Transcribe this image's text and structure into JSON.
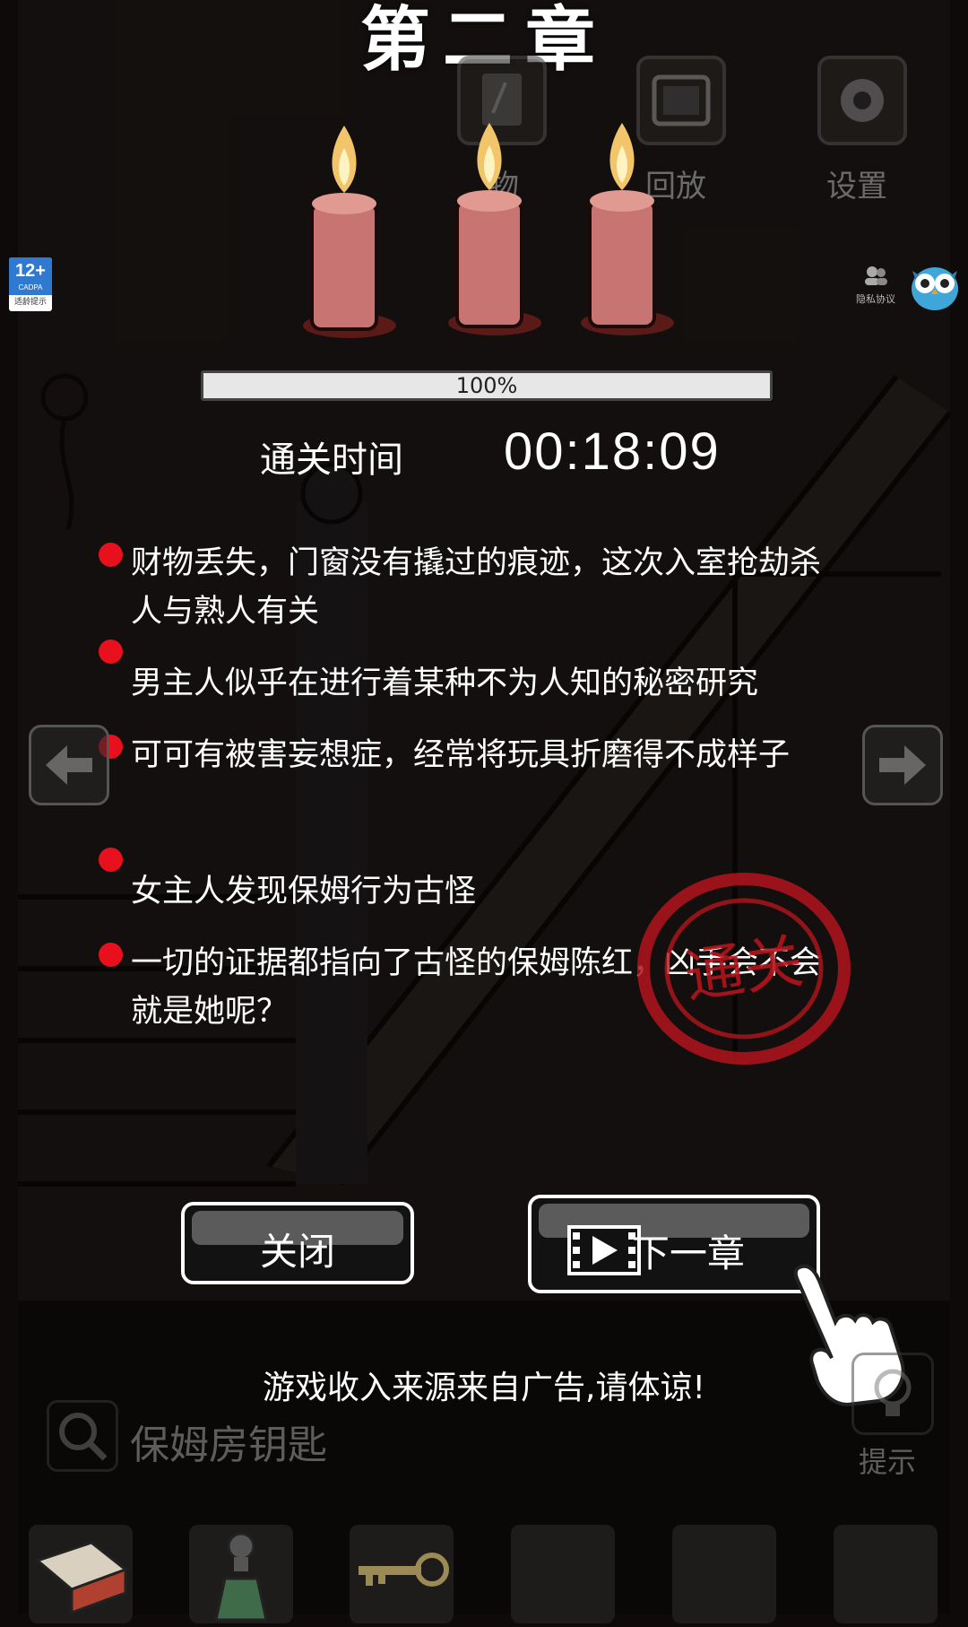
{
  "chapter_title": "第二章",
  "top_bar": {
    "items_label": "物",
    "replay_label": "回放",
    "settings_label": "设置"
  },
  "age_rating": {
    "age": "12+",
    "org": "CADPA",
    "note": "适龄提示"
  },
  "privacy_label": "隐私协议",
  "progress": {
    "text": "100%",
    "value": 1.0
  },
  "clear_time": {
    "label": "通关时间",
    "value": "00:18:09"
  },
  "clues": [
    "财物丢失，门窗没有撬过的痕迹，这次入室抢劫杀人与熟人有关",
    "男主人似乎在进行着某种不为人知的秘密研究",
    "可可有被害妄想症，经常将玩具折磨得不成样子",
    "女主人发现保姆行为古怪",
    "一切的证据都指向了古怪的保姆陈红，凶手会不会就是她呢？"
  ],
  "stamp_text": "通关",
  "buttons": {
    "close": "关闭",
    "next_chapter": "下一章"
  },
  "ad_note": "游戏收入来源来自广告,请体谅!",
  "current_item": "保姆房钥匙",
  "hint_label": "提示",
  "colors": {
    "clue_dot": "#e8101c",
    "stamp": "#b3141c",
    "button_border": "#ffffff"
  }
}
